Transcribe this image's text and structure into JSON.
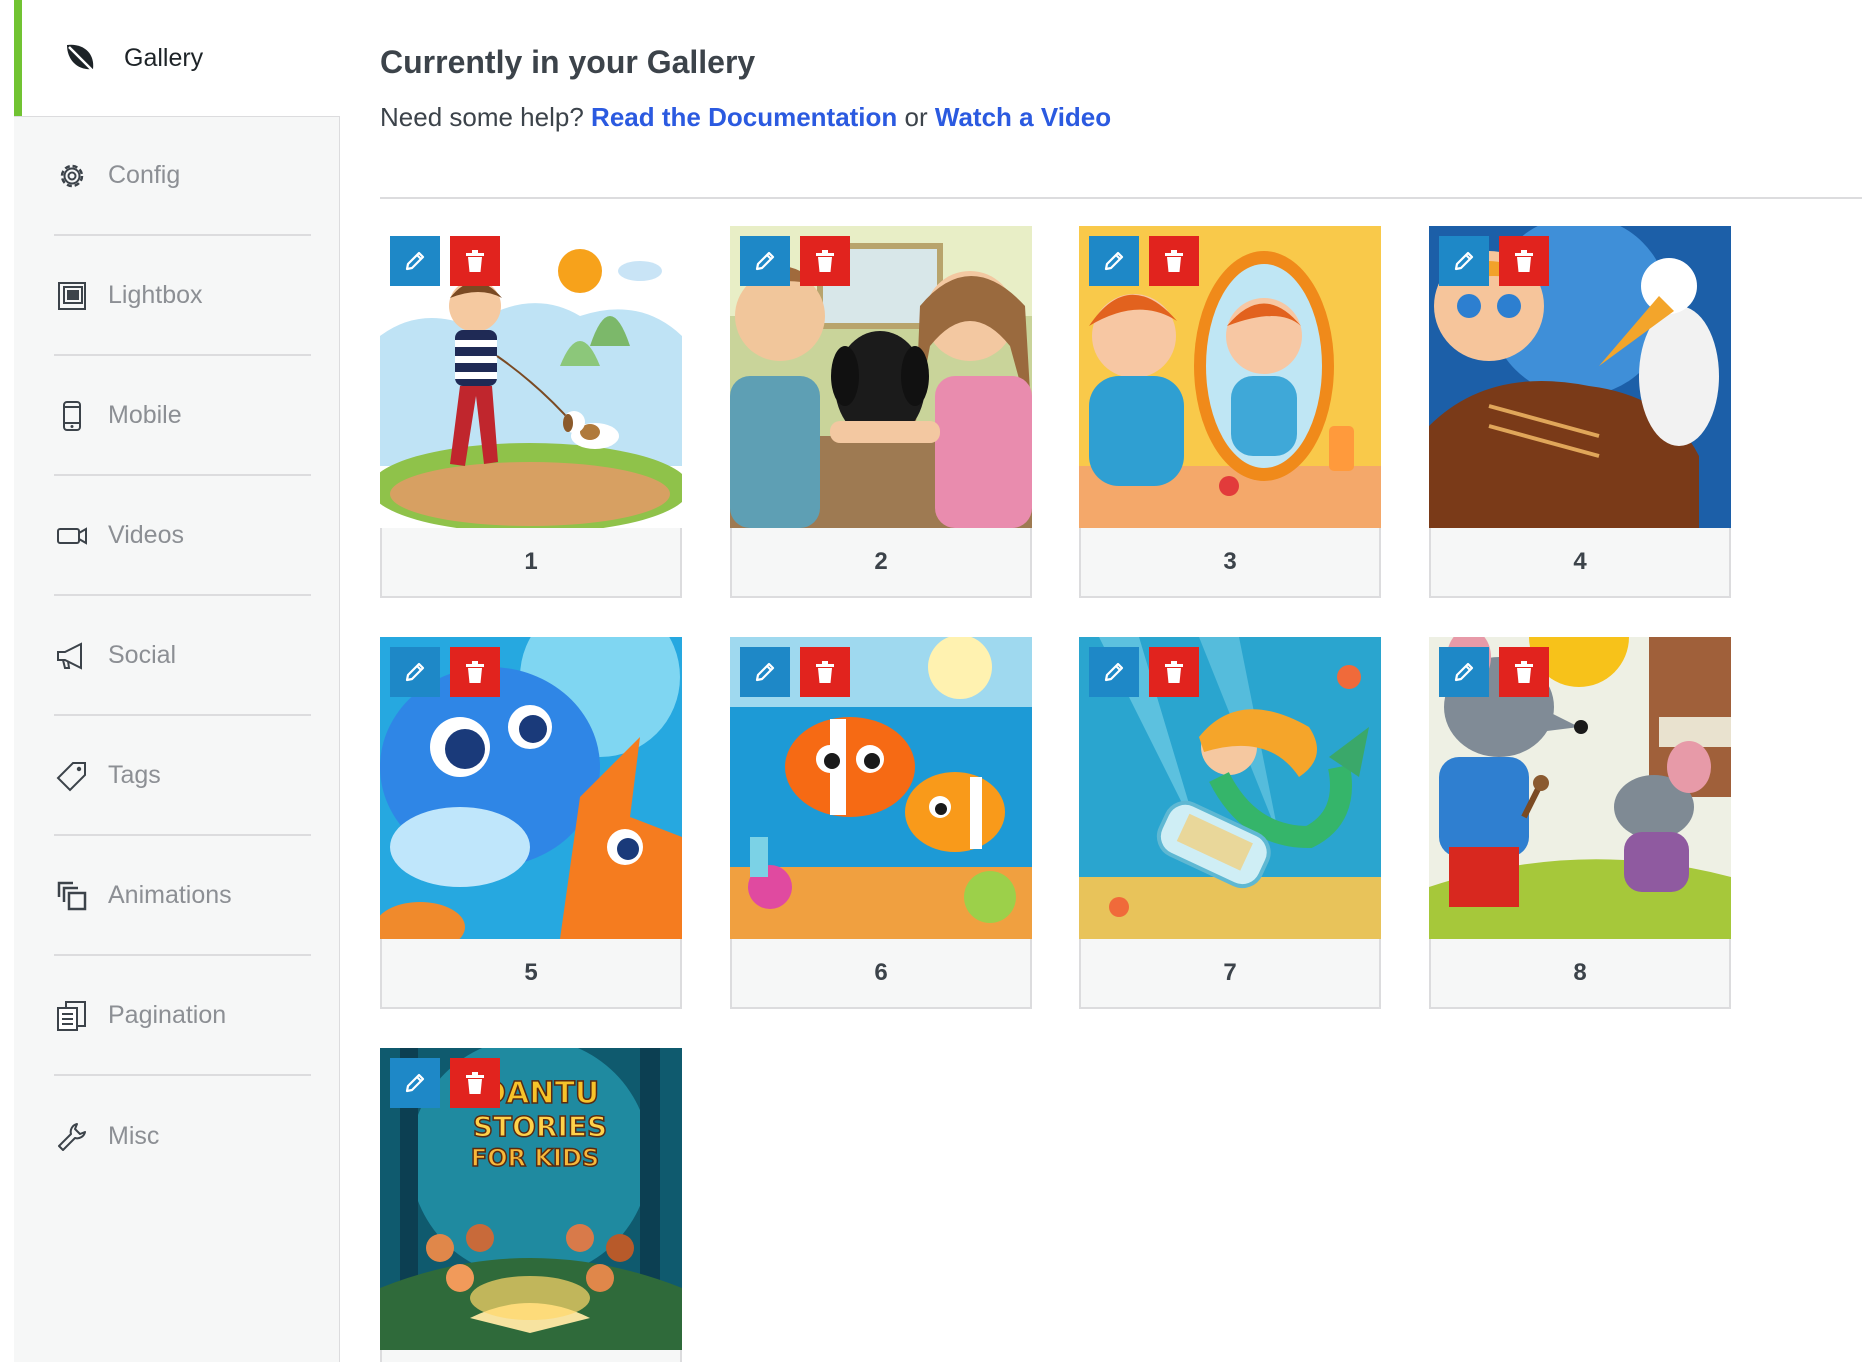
{
  "sidebar": {
    "active": {
      "label": "Gallery",
      "icon": "leaf-icon"
    },
    "items": [
      {
        "label": "Config",
        "icon": "gear-icon"
      },
      {
        "label": "Lightbox",
        "icon": "lightbox-icon"
      },
      {
        "label": "Mobile",
        "icon": "mobile-icon"
      },
      {
        "label": "Videos",
        "icon": "video-camera-icon"
      },
      {
        "label": "Social",
        "icon": "megaphone-icon"
      },
      {
        "label": "Tags",
        "icon": "tag-icon"
      },
      {
        "label": "Animations",
        "icon": "layers-icon"
      },
      {
        "label": "Pagination",
        "icon": "pages-icon"
      },
      {
        "label": "Misc",
        "icon": "wrench-icon"
      }
    ]
  },
  "main": {
    "title": "Currently in your Gallery",
    "help_prefix": "Need some help?",
    "doc_link": "Read the Documentation",
    "or_text": "or",
    "video_link": "Watch a Video"
  },
  "gallery": {
    "items": [
      {
        "caption": "1"
      },
      {
        "caption": "2"
      },
      {
        "caption": "3"
      },
      {
        "caption": "4"
      },
      {
        "caption": "5"
      },
      {
        "caption": "6"
      },
      {
        "caption": "7"
      },
      {
        "caption": "8"
      },
      {
        "caption": ""
      }
    ],
    "poster_text": [
      "EDANTU",
      "STORIES",
      "FOR KIDS"
    ]
  },
  "colors": {
    "accent_green": "#71c332",
    "link_blue": "#2b5ae0",
    "edit_blue": "#1e88c7",
    "delete_red": "#e1231e"
  }
}
